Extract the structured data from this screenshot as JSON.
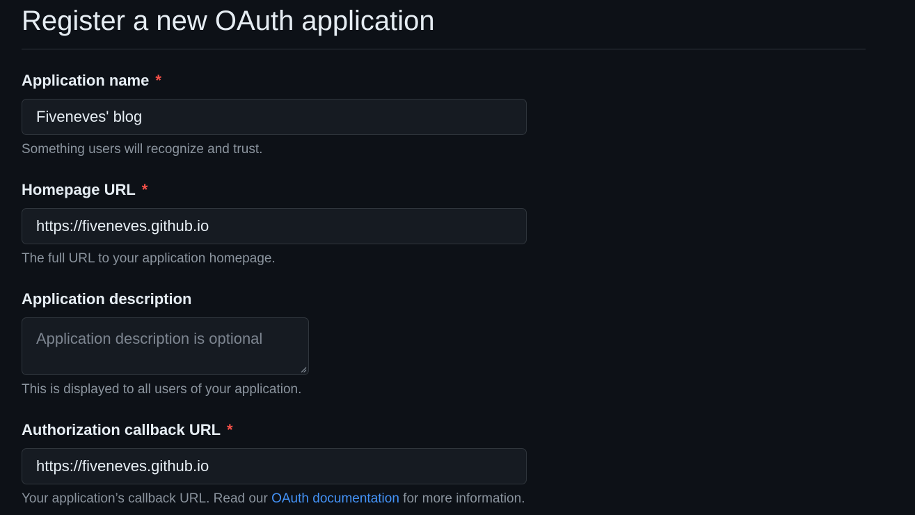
{
  "page": {
    "title": "Register a new OAuth application"
  },
  "fields": {
    "app_name": {
      "label": "Application name",
      "required_mark": "*",
      "value": "Fiveneves' blog",
      "help": "Something users will recognize and trust."
    },
    "homepage_url": {
      "label": "Homepage URL",
      "required_mark": "*",
      "value": "https://fiveneves.github.io",
      "help": "The full URL to your application homepage."
    },
    "description": {
      "label": "Application description",
      "value": "",
      "placeholder": "Application description is optional",
      "help": "This is displayed to all users of your application."
    },
    "callback_url": {
      "label": "Authorization callback URL",
      "required_mark": "*",
      "value": "https://fiveneves.github.io",
      "help_prefix": "Your application’s callback URL. Read our ",
      "help_link": "OAuth documentation",
      "help_suffix": " for more information."
    }
  },
  "colors": {
    "background": "#0d1117",
    "input_background": "#161b22",
    "border": "#30363d",
    "required": "#f85149",
    "link": "#4493f8",
    "muted_text": "#8b949e"
  }
}
